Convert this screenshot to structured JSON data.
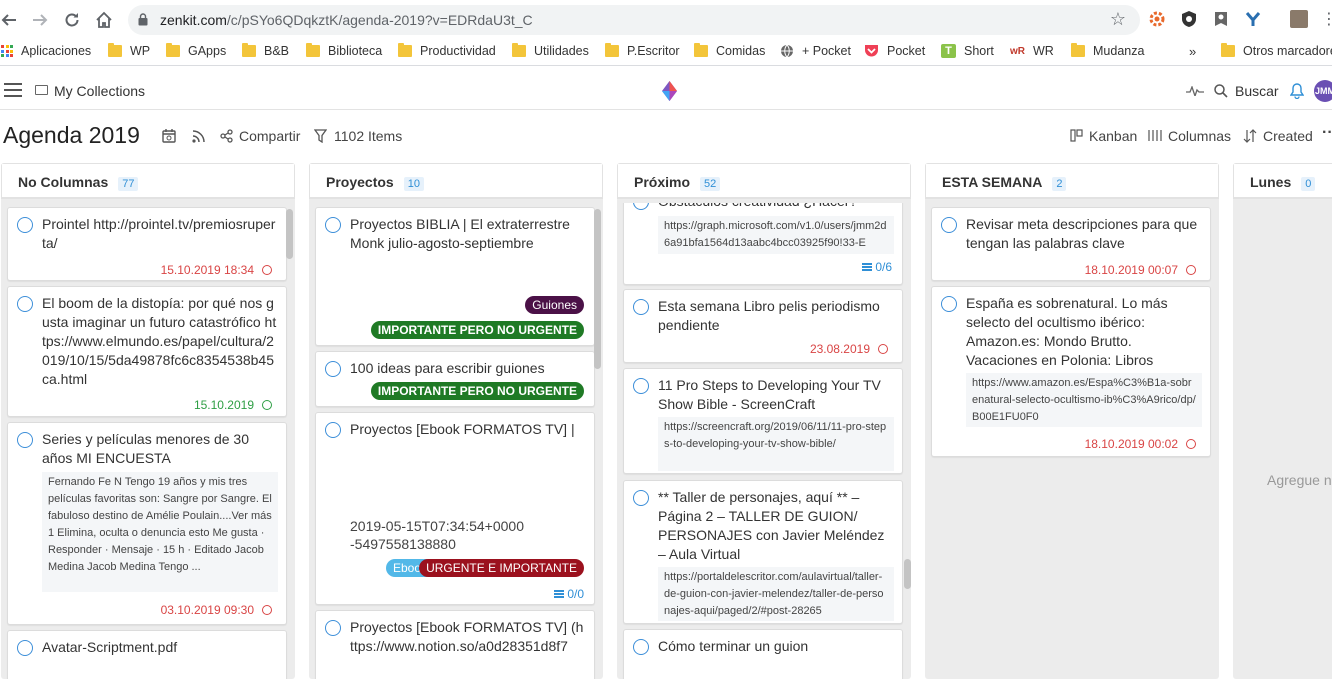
{
  "browser": {
    "url_host": "zenkit.com",
    "url_path": "/c/pSYo6QDqkztK/agenda-2019?v=EDRdaU3t_C",
    "bookmarks": [
      {
        "label": "Aplicaciones",
        "kind": "apps"
      },
      {
        "label": "WP",
        "kind": "folder"
      },
      {
        "label": "GApps",
        "kind": "folder"
      },
      {
        "label": "B&B",
        "kind": "folder"
      },
      {
        "label": "Biblioteca",
        "kind": "folder"
      },
      {
        "label": "Productividad",
        "kind": "folder"
      },
      {
        "label": "Utilidades",
        "kind": "folder"
      },
      {
        "label": "P.Escritor",
        "kind": "folder"
      },
      {
        "label": "Comidas",
        "kind": "folder"
      },
      {
        "label": "+ Pocket",
        "kind": "globe"
      },
      {
        "label": "Pocket",
        "kind": "pocket"
      },
      {
        "label": "Short",
        "kind": "short"
      },
      {
        "label": "WR",
        "kind": "wr"
      },
      {
        "label": "Mudanza",
        "kind": "folder"
      },
      {
        "label": "»",
        "kind": "more"
      },
      {
        "label": "Otros marcadores",
        "kind": "folder"
      }
    ]
  },
  "header": {
    "collections": "My Collections",
    "search": "Buscar",
    "avatar": "JMM"
  },
  "toolbar": {
    "title": "Agenda 2019",
    "share": "Compartir",
    "items": "1102 Items",
    "view_kanban": "Kanban",
    "view_columns": "Columnas",
    "sort": "Created",
    "more": "···"
  },
  "colors": {
    "accent": "#2f8fd6",
    "date_red": "#d94545",
    "date_green": "#2e9e44",
    "tag_guiones": "#4b1147",
    "tag_importante": "#1f7a25",
    "tag_urgente": "#9b111e",
    "tag_ebook": "#52b8e8"
  },
  "columns": [
    {
      "name": "No Columnas",
      "count": "77",
      "cards": [
        {
          "title": "Prointel http://prointel.tv/premiosruperta/",
          "date": "15.10.2019 18:34"
        },
        {
          "title": "El boom de la distopía: por qué nos gusta imaginar un futuro catastrófico https://www.elmundo.es/papel/cultura/2019/10/15/5da49878fc6c8354538b45ca.html",
          "date": "15.10.2019"
        },
        {
          "title": "Series y películas menores de 30 años MI ENCUESTA",
          "desc": "Fernando Fe N Tengo 19 años y mis tres películas favoritas son: Sangre por Sangre. El fabuloso destino de Amélie Poulain....Ver más 1 Elimina, oculta o denuncia esto Me gusta · Responder · Mensaje · 15 h · Editado Jacob Medina Jacob Medina Tengo ...",
          "date": "03.10.2019 09:30"
        },
        {
          "title": "Avatar-Scriptment.pdf"
        }
      ]
    },
    {
      "name": "Proyectos",
      "count": "10",
      "cards": [
        {
          "title": "Proyectos BIBLIA | El extraterrestre Monk julio-agosto-septiembre",
          "tag1": "Guiones",
          "tag2": "IMPORTANTE PERO NO URGENTE"
        },
        {
          "title": "100 ideas para escribir guiones",
          "tag1": "IMPORTANTE PERO NO URGENTE"
        },
        {
          "title": "Proyectos [Ebook FORMATOS TV] |",
          "desc_line1": "2019-05-15T07:34:54+0000",
          "desc_line2": "-5497558138880",
          "tag1": "Ebook",
          "tag2": "URGENTE E IMPORTANTE",
          "subtasks": "0/0"
        },
        {
          "title": "Proyectos [Ebook FORMATOS TV] (https://www.notion.so/a0d28351d8f7"
        }
      ]
    },
    {
      "name": "Próximo",
      "count": "52",
      "cards": [
        {
          "title": "Obstáculos creatividad ¿Hacer?",
          "desc": "https://graph.microsoft.com/v1.0/users/jmm2d6a91bfa1564d13aabc4bcc03925f90!33-E",
          "subtasks": "0/6"
        },
        {
          "title": "Esta semana Libro pelis periodismo pendiente",
          "date": "23.08.2019"
        },
        {
          "title": "11 Pro Steps to Developing Your TV Show Bible - ScreenCraft",
          "desc": "https://screencraft.org/2019/06/11/11-pro-steps-to-developing-your-tv-show-bible/"
        },
        {
          "title": "** Taller de personajes, aquí ** – Página 2 – TALLER DE GUION/ PERSONAJES con Javier Meléndez – Aula Virtual",
          "desc": "https://portaldelescritor.com/aulavirtual/taller-de-guion-con-javier-melendez/taller-de-personajes-aqui/paged/2/#post-28265"
        },
        {
          "title": "Cómo terminar un guion"
        }
      ]
    },
    {
      "name": "ESTA SEMANA",
      "count": "2",
      "cards": [
        {
          "title": "Revisar meta descripciones para que tengan las palabras clave",
          "date": "18.10.2019 00:07"
        },
        {
          "title": "España es sobrenatural. Lo más selecto del ocultismo ibérico: Amazon.es: Mondo Brutto. Vacaciones en Polonia: Libros",
          "desc": "https://www.amazon.es/Espa%C3%B1a-sobrenatural-selecto-ocultismo-ib%C3%A9rico/dp/B00E1FU0F0",
          "date": "18.10.2019 00:02"
        }
      ]
    },
    {
      "name": "Lunes",
      "count": "0",
      "empty_text": "Agregue n"
    }
  ]
}
